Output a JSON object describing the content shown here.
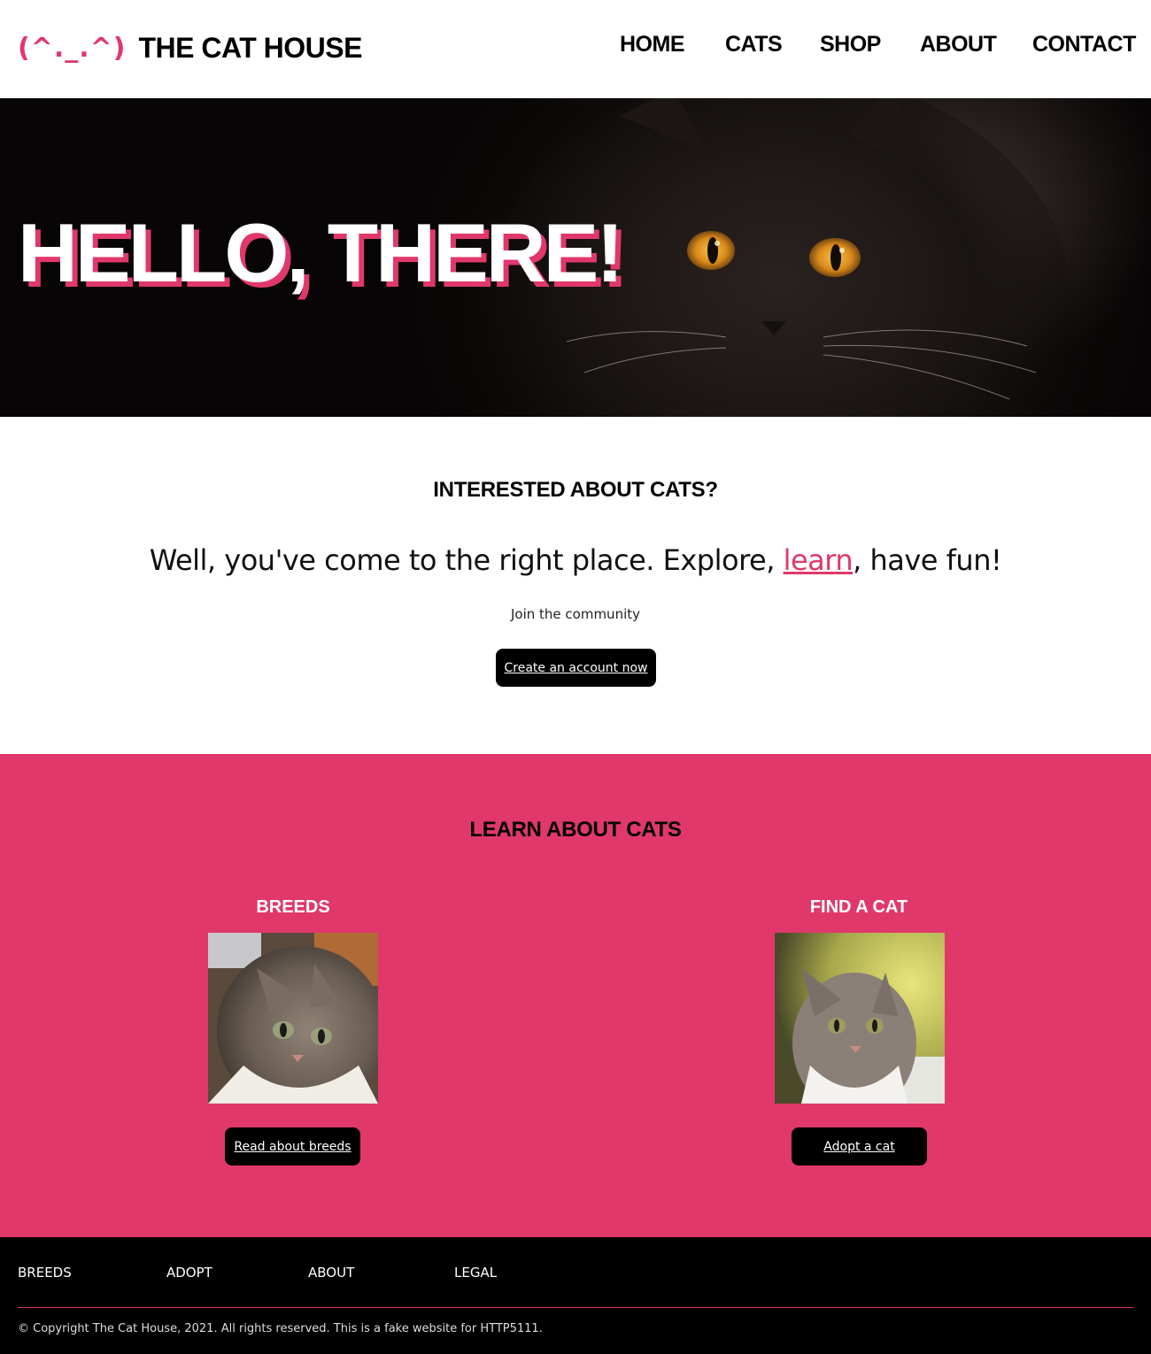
{
  "header": {
    "logo_face": "(^._.^)",
    "site_title": "THE CAT HOUSE",
    "nav": [
      {
        "label": "HOME"
      },
      {
        "label": "CATS"
      },
      {
        "label": "SHOP"
      },
      {
        "label": "ABOUT"
      },
      {
        "label": "CONTACT"
      }
    ]
  },
  "hero": {
    "title": "HELLO, THERE!"
  },
  "intro": {
    "heading": "INTERESTED ABOUT CATS?",
    "lead_before": "Well, you've come to the right place. Explore, ",
    "lead_link": "learn",
    "lead_after": ", have fun!",
    "join": "Join the community",
    "cta": "Create an account now"
  },
  "learn": {
    "heading": "LEARN ABOUT CATS",
    "cards": [
      {
        "title": "BREEDS",
        "button": "Read about breeds"
      },
      {
        "title": "FIND A CAT",
        "button": "Adopt a cat"
      }
    ]
  },
  "footer": {
    "links": [
      {
        "label": "BREEDS"
      },
      {
        "label": "ADOPT"
      },
      {
        "label": "ABOUT"
      },
      {
        "label": "LEGAL"
      }
    ],
    "copyright": "© Copyright The Cat House, 2021. All rights reserved. This is a fake website for HTTP5111."
  },
  "colors": {
    "accent": "#e0386b",
    "footer_bg": "#000000",
    "button_bg": "#000000"
  }
}
